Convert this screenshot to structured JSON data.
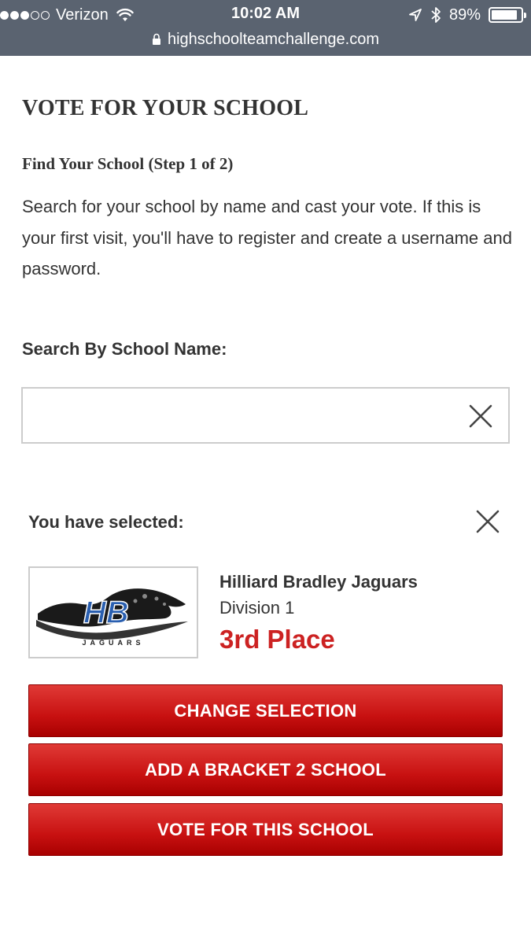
{
  "status_bar": {
    "carrier": "Verizon",
    "time": "10:02 AM",
    "battery": "89%",
    "battery_level": 0.89,
    "signal_bars_filled": 3,
    "signal_bars_total": 5,
    "url": "highschoolteamchallenge.com"
  },
  "page": {
    "title": "VOTE FOR YOUR SCHOOL",
    "step_title": "Find Your School (Step 1 of 2)",
    "intro": "Search for your school by name and cast your vote. If this is your first visit, you'll have to register and create a username and password."
  },
  "search": {
    "label": "Search By School Name:",
    "value": "",
    "placeholder": ""
  },
  "selection": {
    "label": "You have selected:",
    "school_name": "Hilliard Bradley Jaguars",
    "division": "Division 1",
    "place": "3rd Place",
    "logo_text": "HB",
    "logo_subtext": "JAGUARS"
  },
  "buttons": {
    "change": "CHANGE SELECTION",
    "add_bracket": "ADD A BRACKET 2 SCHOOL",
    "vote": "VOTE FOR THIS SCHOOL"
  },
  "colors": {
    "status_bar_bg": "#5a6370",
    "button_red": "#c81111",
    "place_red": "#cc2222",
    "text": "#333333",
    "logo_blue": "#2a5fb0"
  },
  "icons": {
    "search_clear": "close-icon",
    "deselect": "close-icon",
    "lock": "lock-icon",
    "wifi": "wifi-icon",
    "location": "location-arrow-icon",
    "bluetooth": "bluetooth-icon",
    "battery": "battery-icon"
  }
}
